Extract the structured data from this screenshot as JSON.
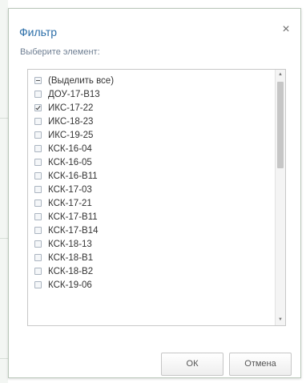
{
  "dialog": {
    "title": "Фильтр",
    "close_glyph": "×",
    "subtitle": "Выберите элемент:"
  },
  "list": {
    "items": [
      {
        "label": "(Выделить все)",
        "state": "mixed"
      },
      {
        "label": "ДОУ-17-В13",
        "state": "unchecked"
      },
      {
        "label": "ИКС-17-22",
        "state": "checked"
      },
      {
        "label": "ИКС-18-23",
        "state": "unchecked"
      },
      {
        "label": "ИКС-19-25",
        "state": "unchecked"
      },
      {
        "label": "КСК-16-04",
        "state": "unchecked"
      },
      {
        "label": "КСК-16-05",
        "state": "unchecked"
      },
      {
        "label": "КСК-16-В11",
        "state": "unchecked"
      },
      {
        "label": "КСК-17-03",
        "state": "unchecked"
      },
      {
        "label": "КСК-17-21",
        "state": "unchecked"
      },
      {
        "label": "КСК-17-В11",
        "state": "unchecked"
      },
      {
        "label": "КСК-17-В14",
        "state": "unchecked"
      },
      {
        "label": "КСК-18-13",
        "state": "unchecked"
      },
      {
        "label": "КСК-18-В1",
        "state": "unchecked"
      },
      {
        "label": "КСК-18-В2",
        "state": "unchecked"
      },
      {
        "label": "КСК-19-06",
        "state": "unchecked"
      }
    ]
  },
  "buttons": {
    "ok_label": "ОК",
    "cancel_label": "Отмена"
  },
  "colors": {
    "title": "#2b6ea8",
    "border": "#b9c7b9",
    "subtitle": "#6f7f93"
  }
}
